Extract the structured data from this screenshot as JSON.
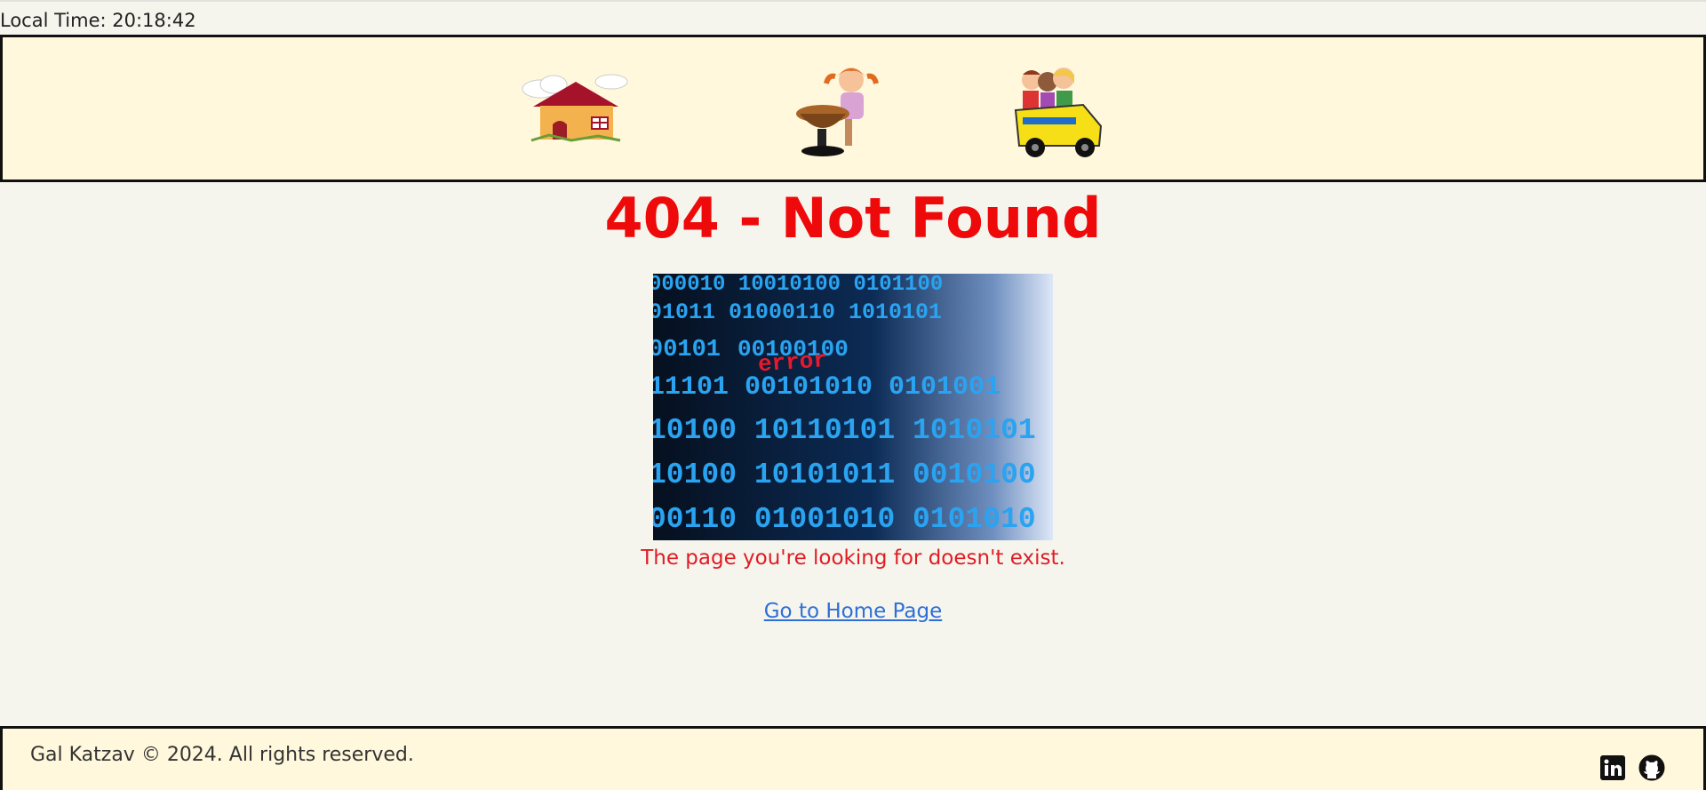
{
  "top_bar": {
    "local_time": "Local Time: 20:18:42"
  },
  "header": {
    "nav": [
      {
        "icon": "house-icon"
      },
      {
        "icon": "student-at-desk-icon"
      },
      {
        "icon": "school-bus-icon"
      }
    ]
  },
  "main": {
    "title": "404 - Not Found",
    "image_icon": "binary-error-image",
    "image_text": "error",
    "message": "The page you're looking for doesn't exist.",
    "home_link": "Go to Home Page"
  },
  "footer": {
    "copyright": "Gal Katzav © 2024. All rights reserved.",
    "social": [
      {
        "icon": "linkedin-icon"
      },
      {
        "icon": "github-icon"
      }
    ]
  },
  "colors": {
    "title": "#ee0a0a",
    "message": "#e01c24",
    "link": "#2d6fd6",
    "header_bg": "#fff8dc",
    "page_bg": "#f5f5ee"
  }
}
